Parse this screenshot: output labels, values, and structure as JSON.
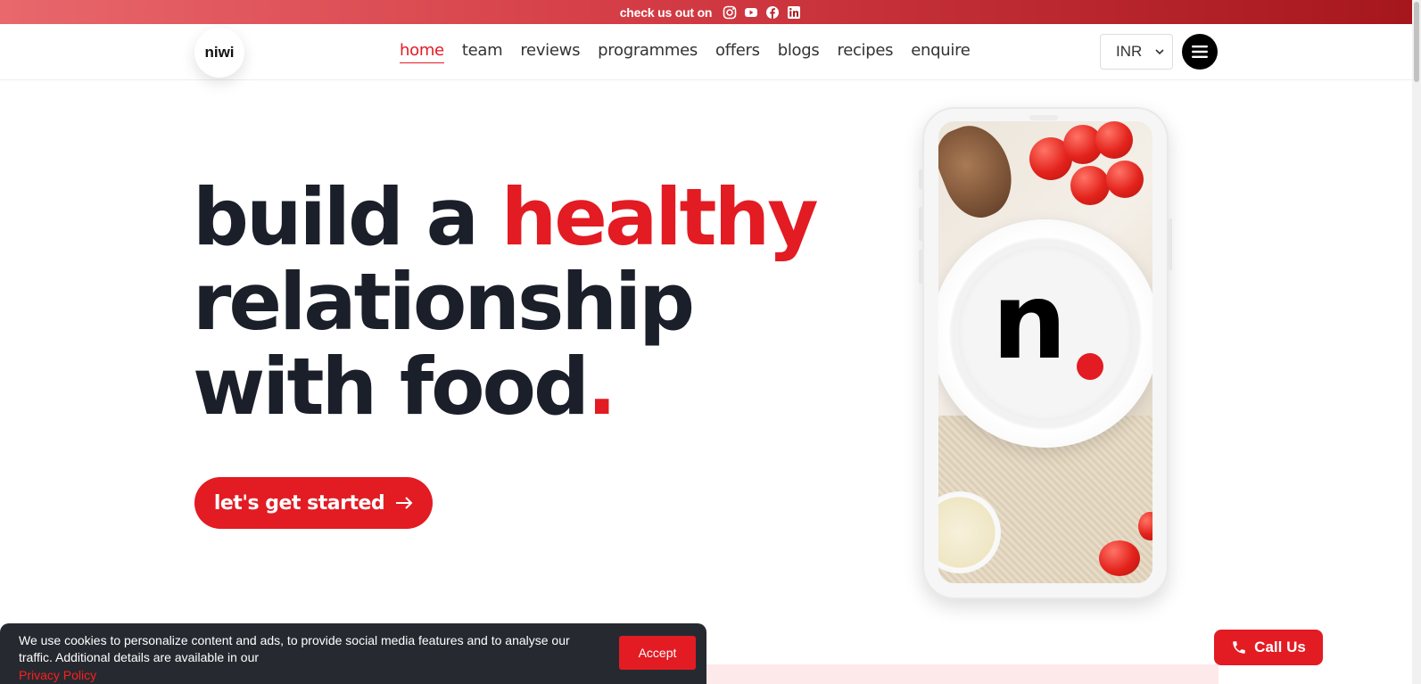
{
  "topbar": {
    "promo": "check us out on",
    "socials": [
      "instagram-icon",
      "youtube-icon",
      "facebook-icon",
      "linkedin-icon"
    ]
  },
  "header": {
    "logo": "niwi",
    "nav": [
      {
        "label": "home",
        "active": true
      },
      {
        "label": "team"
      },
      {
        "label": "reviews"
      },
      {
        "label": "programmes"
      },
      {
        "label": "offers"
      },
      {
        "label": "blogs"
      },
      {
        "label": "recipes"
      },
      {
        "label": "enquire"
      }
    ],
    "currency": "INR"
  },
  "hero": {
    "line1_prefix": "build a ",
    "line1_accent": "healthy",
    "line2": "relationship",
    "line3": "with food",
    "line3_accent": ".",
    "cta": "let's get started",
    "phone_brand_letter": "n"
  },
  "cookie": {
    "text": "We use cookies to personalize content and ads, to provide social media features and to analyse our traffic. Additional details are available in our",
    "link": "Privacy Policy",
    "accept": "Accept"
  },
  "call": {
    "label": "Call Us"
  },
  "colors": {
    "accent": "#e31b23",
    "dark": "#1b1f2a",
    "cookie_bg": "#262a30"
  }
}
